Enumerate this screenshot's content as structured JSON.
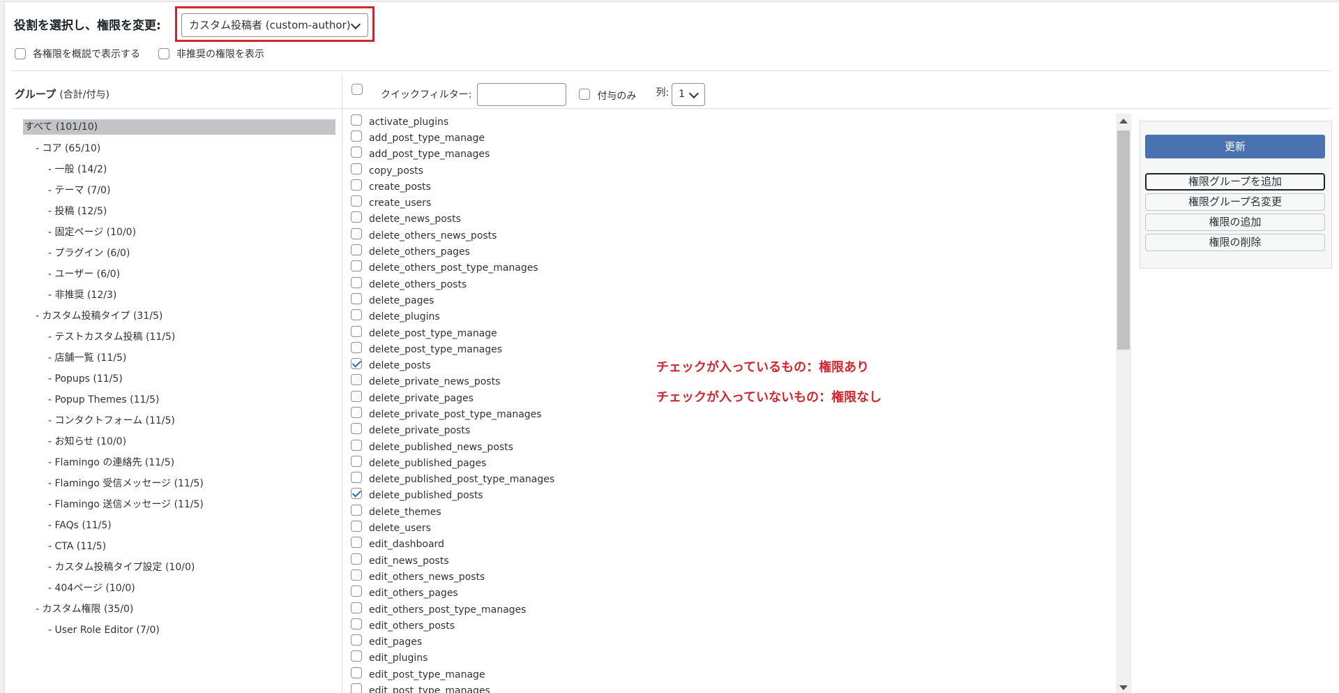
{
  "header": {
    "role_label": "役割を選択し、権限を変更:",
    "role_selected": "カスタム投稿者 (custom-author)"
  },
  "options": {
    "show_human_readable": "各権限を概説で表示する",
    "show_deprecated": "非推奨の権限を表示"
  },
  "groups": {
    "title": "グループ",
    "title_sub": "(合計/付与)",
    "items": [
      {
        "label": "すべて (101/10)",
        "level": 0
      },
      {
        "label": "- コア (65/10)",
        "level": 1
      },
      {
        "label": "- 一般 (14/2)",
        "level": 2
      },
      {
        "label": "- テーマ (7/0)",
        "level": 2
      },
      {
        "label": "- 投稿 (12/5)",
        "level": 2
      },
      {
        "label": "- 固定ページ (10/0)",
        "level": 2
      },
      {
        "label": "- プラグイン (6/0)",
        "level": 2
      },
      {
        "label": "- ユーザー (6/0)",
        "level": 2
      },
      {
        "label": "- 非推奨 (12/3)",
        "level": 2
      },
      {
        "label": "- カスタム投稿タイプ (31/5)",
        "level": 1
      },
      {
        "label": "- テストカスタム投稿 (11/5)",
        "level": 2
      },
      {
        "label": "- 店舗一覧 (11/5)",
        "level": 2
      },
      {
        "label": "- Popups (11/5)",
        "level": 2
      },
      {
        "label": "- Popup Themes (11/5)",
        "level": 2
      },
      {
        "label": "- コンタクトフォーム (11/5)",
        "level": 2
      },
      {
        "label": "- お知らせ (10/0)",
        "level": 2
      },
      {
        "label": "- Flamingo の連絡先 (11/5)",
        "level": 2
      },
      {
        "label": "- Flamingo 受信メッセージ (11/5)",
        "level": 2
      },
      {
        "label": "- Flamingo 送信メッセージ (11/5)",
        "level": 2
      },
      {
        "label": "- FAQs (11/5)",
        "level": 2
      },
      {
        "label": "- CTA (11/5)",
        "level": 2
      },
      {
        "label": "- カスタム投稿タイプ設定 (10/0)",
        "level": 2
      },
      {
        "label": "- 404ページ (10/0)",
        "level": 2
      },
      {
        "label": "- カスタム権限 (35/0)",
        "level": 1
      },
      {
        "label": "- User Role Editor (7/0)",
        "level": 2
      }
    ]
  },
  "filter": {
    "quick_filter_label": "クイックフィルター:",
    "quick_filter_value": "",
    "granted_only_label": "付与のみ",
    "columns_label": "列:",
    "columns_value": "1"
  },
  "capabilities": [
    {
      "name": "activate_plugins",
      "checked": false
    },
    {
      "name": "add_post_type_manage",
      "checked": false
    },
    {
      "name": "add_post_type_manages",
      "checked": false
    },
    {
      "name": "copy_posts",
      "checked": false
    },
    {
      "name": "create_posts",
      "checked": false
    },
    {
      "name": "create_users",
      "checked": false
    },
    {
      "name": "delete_news_posts",
      "checked": false
    },
    {
      "name": "delete_others_news_posts",
      "checked": false
    },
    {
      "name": "delete_others_pages",
      "checked": false
    },
    {
      "name": "delete_others_post_type_manages",
      "checked": false
    },
    {
      "name": "delete_others_posts",
      "checked": false
    },
    {
      "name": "delete_pages",
      "checked": false
    },
    {
      "name": "delete_plugins",
      "checked": false
    },
    {
      "name": "delete_post_type_manage",
      "checked": false
    },
    {
      "name": "delete_post_type_manages",
      "checked": false
    },
    {
      "name": "delete_posts",
      "checked": true
    },
    {
      "name": "delete_private_news_posts",
      "checked": false
    },
    {
      "name": "delete_private_pages",
      "checked": false
    },
    {
      "name": "delete_private_post_type_manages",
      "checked": false
    },
    {
      "name": "delete_private_posts",
      "checked": false
    },
    {
      "name": "delete_published_news_posts",
      "checked": false
    },
    {
      "name": "delete_published_pages",
      "checked": false
    },
    {
      "name": "delete_published_post_type_manages",
      "checked": false
    },
    {
      "name": "delete_published_posts",
      "checked": true
    },
    {
      "name": "delete_themes",
      "checked": false
    },
    {
      "name": "delete_users",
      "checked": false
    },
    {
      "name": "edit_dashboard",
      "checked": false
    },
    {
      "name": "edit_news_posts",
      "checked": false
    },
    {
      "name": "edit_others_news_posts",
      "checked": false
    },
    {
      "name": "edit_others_pages",
      "checked": false
    },
    {
      "name": "edit_others_post_type_manages",
      "checked": false
    },
    {
      "name": "edit_others_posts",
      "checked": false
    },
    {
      "name": "edit_pages",
      "checked": false
    },
    {
      "name": "edit_plugins",
      "checked": false
    },
    {
      "name": "edit_post_type_manage",
      "checked": false
    },
    {
      "name": "edit_post_type_manages",
      "checked": false
    }
  ],
  "notes": {
    "checked": "チェックが入っているもの：権限あり",
    "unchecked": "チェックが入っていないもの：権限なし"
  },
  "actions": {
    "update": "更新",
    "add_group": "権限グループを追加",
    "rename_group": "権限グループ名変更",
    "add_capability": "権限の追加",
    "delete_capability": "権限の削除"
  },
  "colors": {
    "highlight_border": "#d0262d",
    "note_text": "#d0262d",
    "update_button": "#4a72b0"
  }
}
